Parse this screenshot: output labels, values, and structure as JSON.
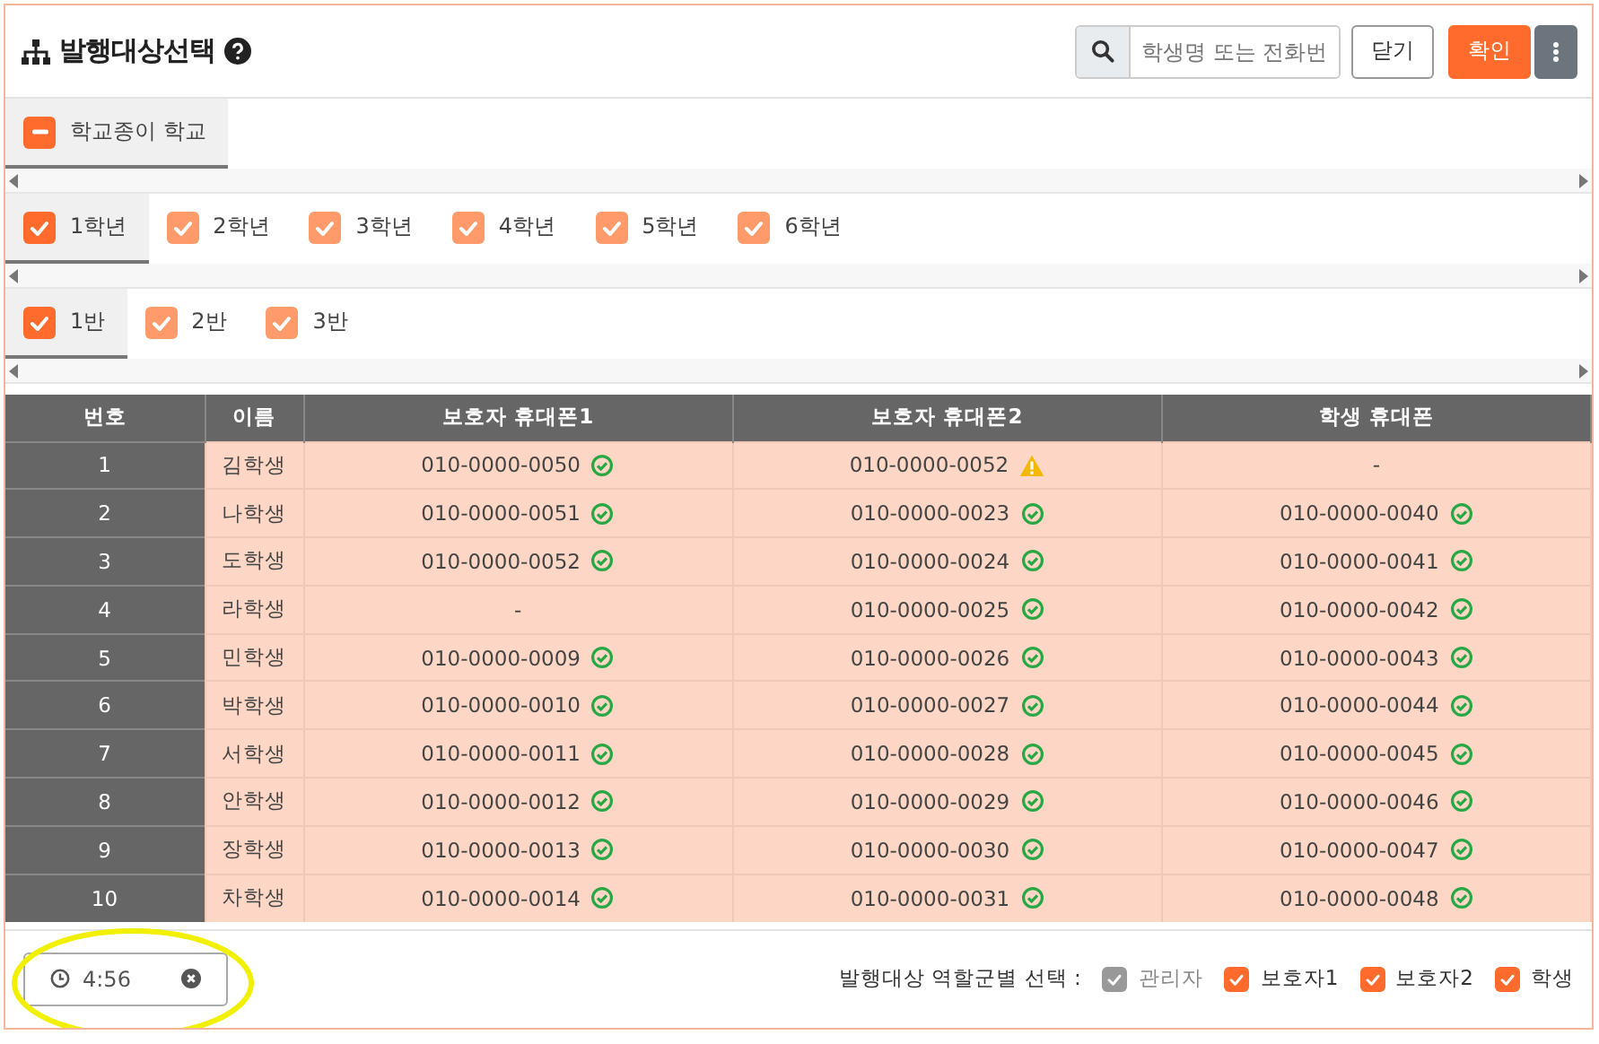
{
  "header": {
    "title": "발행대상선택",
    "search": {
      "placeholder": "학생명 또는 전화번"
    },
    "buttons": [
      {
        "label": "닫기",
        "kind": "secondary"
      },
      {
        "label": "확인",
        "kind": "primary"
      }
    ]
  },
  "schools": [
    {
      "label": "학교종이 학교",
      "indeterminate": true,
      "selected": true
    }
  ],
  "grades": [
    {
      "label": "1학년",
      "checked": true,
      "selected": true
    },
    {
      "label": "2학년",
      "checked": true,
      "selected": false
    },
    {
      "label": "3학년",
      "checked": true,
      "selected": false
    },
    {
      "label": "4학년",
      "checked": true,
      "selected": false
    },
    {
      "label": "5학년",
      "checked": true,
      "selected": false
    },
    {
      "label": "6학년",
      "checked": true,
      "selected": false
    }
  ],
  "classes": [
    {
      "label": "1반",
      "checked": true,
      "selected": true
    },
    {
      "label": "2반",
      "checked": true,
      "selected": false
    },
    {
      "label": "3반",
      "checked": true,
      "selected": false
    }
  ],
  "table": {
    "columns": [
      "번호",
      "이름",
      "보호자 휴대폰1",
      "보호자 휴대폰2",
      "학생 휴대폰"
    ],
    "rows": [
      {
        "no": "1",
        "name": "김학생",
        "phones": [
          {
            "number": "010-0000-0050",
            "kind": "ok"
          },
          {
            "number": "010-0000-0052",
            "kind": "warning"
          },
          {
            "number": "-",
            "kind": "empty"
          }
        ]
      },
      {
        "no": "2",
        "name": "나학생",
        "phones": [
          {
            "number": "010-0000-0051",
            "kind": "ok"
          },
          {
            "number": "010-0000-0023",
            "kind": "ok"
          },
          {
            "number": "010-0000-0040",
            "kind": "ok"
          }
        ]
      },
      {
        "no": "3",
        "name": "도학생",
        "phones": [
          {
            "number": "010-0000-0052",
            "kind": "ok"
          },
          {
            "number": "010-0000-0024",
            "kind": "ok"
          },
          {
            "number": "010-0000-0041",
            "kind": "ok"
          }
        ]
      },
      {
        "no": "4",
        "name": "라학생",
        "phones": [
          {
            "number": "-",
            "kind": "empty"
          },
          {
            "number": "010-0000-0025",
            "kind": "ok"
          },
          {
            "number": "010-0000-0042",
            "kind": "ok"
          }
        ]
      },
      {
        "no": "5",
        "name": "민학생",
        "phones": [
          {
            "number": "010-0000-0009",
            "kind": "ok"
          },
          {
            "number": "010-0000-0026",
            "kind": "ok"
          },
          {
            "number": "010-0000-0043",
            "kind": "ok"
          }
        ]
      },
      {
        "no": "6",
        "name": "박학생",
        "phones": [
          {
            "number": "010-0000-0010",
            "kind": "ok"
          },
          {
            "number": "010-0000-0027",
            "kind": "ok"
          },
          {
            "number": "010-0000-0044",
            "kind": "ok"
          }
        ]
      },
      {
        "no": "7",
        "name": "서학생",
        "phones": [
          {
            "number": "010-0000-0011",
            "kind": "ok"
          },
          {
            "number": "010-0000-0028",
            "kind": "ok"
          },
          {
            "number": "010-0000-0045",
            "kind": "ok"
          }
        ]
      },
      {
        "no": "8",
        "name": "안학생",
        "phones": [
          {
            "number": "010-0000-0012",
            "kind": "ok"
          },
          {
            "number": "010-0000-0029",
            "kind": "ok"
          },
          {
            "number": "010-0000-0046",
            "kind": "ok"
          }
        ]
      },
      {
        "no": "9",
        "name": "장학생",
        "phones": [
          {
            "number": "010-0000-0013",
            "kind": "ok"
          },
          {
            "number": "010-0000-0030",
            "kind": "ok"
          },
          {
            "number": "010-0000-0047",
            "kind": "ok"
          }
        ]
      },
      {
        "no": "10",
        "name": "차학생",
        "phones": [
          {
            "number": "010-0000-0014",
            "kind": "ok"
          },
          {
            "number": "010-0000-0031",
            "kind": "ok"
          },
          {
            "number": "010-0000-0048",
            "kind": "ok"
          }
        ]
      }
    ]
  },
  "footer": {
    "timer": {
      "value": "4:56",
      "highlighted": true
    },
    "roles_label": "발행대상 역할군별 선택 :",
    "roles": [
      {
        "label": "관리자",
        "checked": true,
        "disabled": true
      },
      {
        "label": "보호자1",
        "checked": true,
        "disabled": false
      },
      {
        "label": "보호자2",
        "checked": true,
        "disabled": false
      },
      {
        "label": "학생",
        "checked": true,
        "disabled": false
      }
    ]
  }
}
